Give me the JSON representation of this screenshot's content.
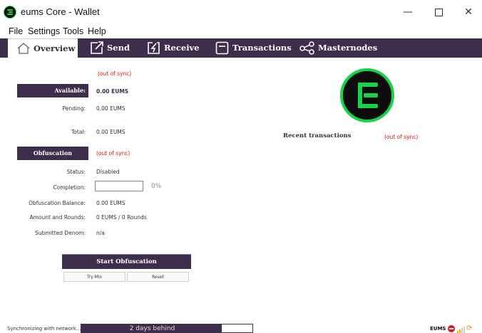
{
  "window": {
    "title": "eums Core - Wallet"
  },
  "menu": [
    "File",
    "Settings",
    "Tools",
    "Help"
  ],
  "tabs": [
    {
      "label": "Overview",
      "icon": "home-icon"
    },
    {
      "label": "Send",
      "icon": "send-icon"
    },
    {
      "label": "Receive",
      "icon": "receive-icon"
    },
    {
      "label": "Transactions",
      "icon": "transactions-icon"
    },
    {
      "label": "Masternodes",
      "icon": "share-icon"
    }
  ],
  "balances": {
    "out_of_sync": "(out of sync)",
    "available_label": "Available:",
    "available_value": "0.00 EUMS",
    "pending_label": "Pending:",
    "pending_value": "0.00 EUMS",
    "total_label": "Total:",
    "total_value": "0.00 EUMS"
  },
  "obfuscation": {
    "title": "Obfuscation",
    "out_of_sync": "(out of sync)",
    "status_label": "Status:",
    "status_value": "Disabled",
    "completion_label": "Completion:",
    "completion_percent": "0%",
    "completion_fraction": 0,
    "balance_label": "Obfuscation Balance:",
    "balance_value": "0.00 EUMS",
    "rounds_label": "Amount and Rounds:",
    "rounds_value": "0 EUMS / 0 Rounds",
    "denom_label": "Submitted Denom:",
    "denom_value": "n/a",
    "start_button": "Start Obfuscation",
    "try_mix_button": "Try Mix",
    "reset_button": "Reset"
  },
  "recent": {
    "title": "Recent transactions",
    "out_of_sync": "(out of sync)"
  },
  "status_bar": {
    "sync_text": "Synchronizing with network...",
    "progress_text": "2 days behind",
    "progress_fraction": 0.82,
    "unit": "EUMS"
  },
  "colors": {
    "accent": "#3d2e4c",
    "brand_green": "#18d24a",
    "warning_red": "#e01010"
  }
}
